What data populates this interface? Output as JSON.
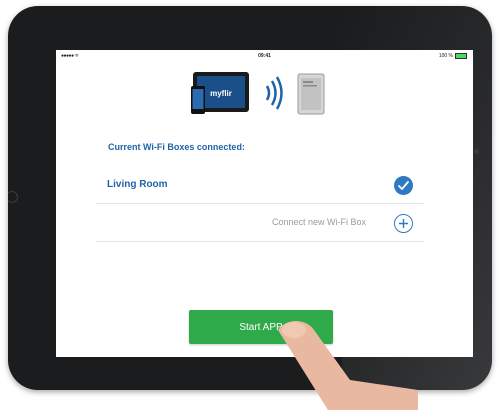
{
  "status_bar": {
    "signal": "●●●●● ᯤ",
    "time": "09:41",
    "battery": "100 %"
  },
  "hero": {
    "tablet_logo": "myflir"
  },
  "section": {
    "title": "Current Wi-Fi Boxes connected:"
  },
  "devices": [
    {
      "label": "Living Room",
      "status": "connected"
    }
  ],
  "connect_new": {
    "label": "Connect new Wi-Fi Box"
  },
  "start_button": {
    "label": "Start APP"
  },
  "colors": {
    "accent_blue": "#1f63a8",
    "start_green": "#2eaa4a",
    "check_blue": "#2f78c2"
  }
}
